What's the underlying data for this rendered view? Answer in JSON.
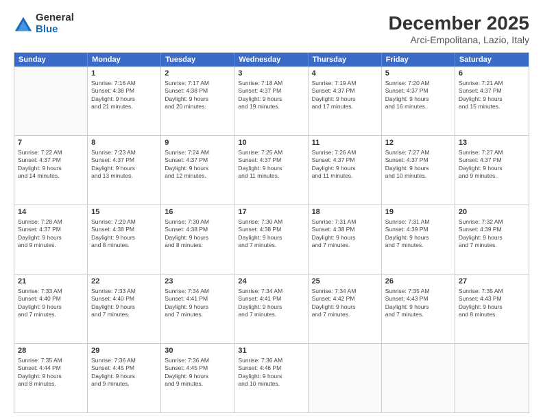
{
  "logo": {
    "general": "General",
    "blue": "Blue"
  },
  "header": {
    "month": "December 2025",
    "location": "Arci-Empolitana, Lazio, Italy"
  },
  "weekdays": [
    "Sunday",
    "Monday",
    "Tuesday",
    "Wednesday",
    "Thursday",
    "Friday",
    "Saturday"
  ],
  "rows": [
    [
      {
        "day": "",
        "text": "",
        "empty": true
      },
      {
        "day": "1",
        "text": "Sunrise: 7:16 AM\nSunset: 4:38 PM\nDaylight: 9 hours\nand 21 minutes."
      },
      {
        "day": "2",
        "text": "Sunrise: 7:17 AM\nSunset: 4:38 PM\nDaylight: 9 hours\nand 20 minutes."
      },
      {
        "day": "3",
        "text": "Sunrise: 7:18 AM\nSunset: 4:37 PM\nDaylight: 9 hours\nand 19 minutes."
      },
      {
        "day": "4",
        "text": "Sunrise: 7:19 AM\nSunset: 4:37 PM\nDaylight: 9 hours\nand 17 minutes."
      },
      {
        "day": "5",
        "text": "Sunrise: 7:20 AM\nSunset: 4:37 PM\nDaylight: 9 hours\nand 16 minutes."
      },
      {
        "day": "6",
        "text": "Sunrise: 7:21 AM\nSunset: 4:37 PM\nDaylight: 9 hours\nand 15 minutes."
      }
    ],
    [
      {
        "day": "7",
        "text": "Sunrise: 7:22 AM\nSunset: 4:37 PM\nDaylight: 9 hours\nand 14 minutes."
      },
      {
        "day": "8",
        "text": "Sunrise: 7:23 AM\nSunset: 4:37 PM\nDaylight: 9 hours\nand 13 minutes."
      },
      {
        "day": "9",
        "text": "Sunrise: 7:24 AM\nSunset: 4:37 PM\nDaylight: 9 hours\nand 12 minutes."
      },
      {
        "day": "10",
        "text": "Sunrise: 7:25 AM\nSunset: 4:37 PM\nDaylight: 9 hours\nand 11 minutes."
      },
      {
        "day": "11",
        "text": "Sunrise: 7:26 AM\nSunset: 4:37 PM\nDaylight: 9 hours\nand 11 minutes."
      },
      {
        "day": "12",
        "text": "Sunrise: 7:27 AM\nSunset: 4:37 PM\nDaylight: 9 hours\nand 10 minutes."
      },
      {
        "day": "13",
        "text": "Sunrise: 7:27 AM\nSunset: 4:37 PM\nDaylight: 9 hours\nand 9 minutes."
      }
    ],
    [
      {
        "day": "14",
        "text": "Sunrise: 7:28 AM\nSunset: 4:37 PM\nDaylight: 9 hours\nand 9 minutes."
      },
      {
        "day": "15",
        "text": "Sunrise: 7:29 AM\nSunset: 4:38 PM\nDaylight: 9 hours\nand 8 minutes."
      },
      {
        "day": "16",
        "text": "Sunrise: 7:30 AM\nSunset: 4:38 PM\nDaylight: 9 hours\nand 8 minutes."
      },
      {
        "day": "17",
        "text": "Sunrise: 7:30 AM\nSunset: 4:38 PM\nDaylight: 9 hours\nand 7 minutes."
      },
      {
        "day": "18",
        "text": "Sunrise: 7:31 AM\nSunset: 4:38 PM\nDaylight: 9 hours\nand 7 minutes."
      },
      {
        "day": "19",
        "text": "Sunrise: 7:31 AM\nSunset: 4:39 PM\nDaylight: 9 hours\nand 7 minutes."
      },
      {
        "day": "20",
        "text": "Sunrise: 7:32 AM\nSunset: 4:39 PM\nDaylight: 9 hours\nand 7 minutes."
      }
    ],
    [
      {
        "day": "21",
        "text": "Sunrise: 7:33 AM\nSunset: 4:40 PM\nDaylight: 9 hours\nand 7 minutes."
      },
      {
        "day": "22",
        "text": "Sunrise: 7:33 AM\nSunset: 4:40 PM\nDaylight: 9 hours\nand 7 minutes."
      },
      {
        "day": "23",
        "text": "Sunrise: 7:34 AM\nSunset: 4:41 PM\nDaylight: 9 hours\nand 7 minutes."
      },
      {
        "day": "24",
        "text": "Sunrise: 7:34 AM\nSunset: 4:41 PM\nDaylight: 9 hours\nand 7 minutes."
      },
      {
        "day": "25",
        "text": "Sunrise: 7:34 AM\nSunset: 4:42 PM\nDaylight: 9 hours\nand 7 minutes."
      },
      {
        "day": "26",
        "text": "Sunrise: 7:35 AM\nSunset: 4:43 PM\nDaylight: 9 hours\nand 7 minutes."
      },
      {
        "day": "27",
        "text": "Sunrise: 7:35 AM\nSunset: 4:43 PM\nDaylight: 9 hours\nand 8 minutes."
      }
    ],
    [
      {
        "day": "28",
        "text": "Sunrise: 7:35 AM\nSunset: 4:44 PM\nDaylight: 9 hours\nand 8 minutes."
      },
      {
        "day": "29",
        "text": "Sunrise: 7:36 AM\nSunset: 4:45 PM\nDaylight: 9 hours\nand 9 minutes."
      },
      {
        "day": "30",
        "text": "Sunrise: 7:36 AM\nSunset: 4:45 PM\nDaylight: 9 hours\nand 9 minutes."
      },
      {
        "day": "31",
        "text": "Sunrise: 7:36 AM\nSunset: 4:46 PM\nDaylight: 9 hours\nand 10 minutes."
      },
      {
        "day": "",
        "text": "",
        "empty": true
      },
      {
        "day": "",
        "text": "",
        "empty": true
      },
      {
        "day": "",
        "text": "",
        "empty": true
      }
    ]
  ]
}
